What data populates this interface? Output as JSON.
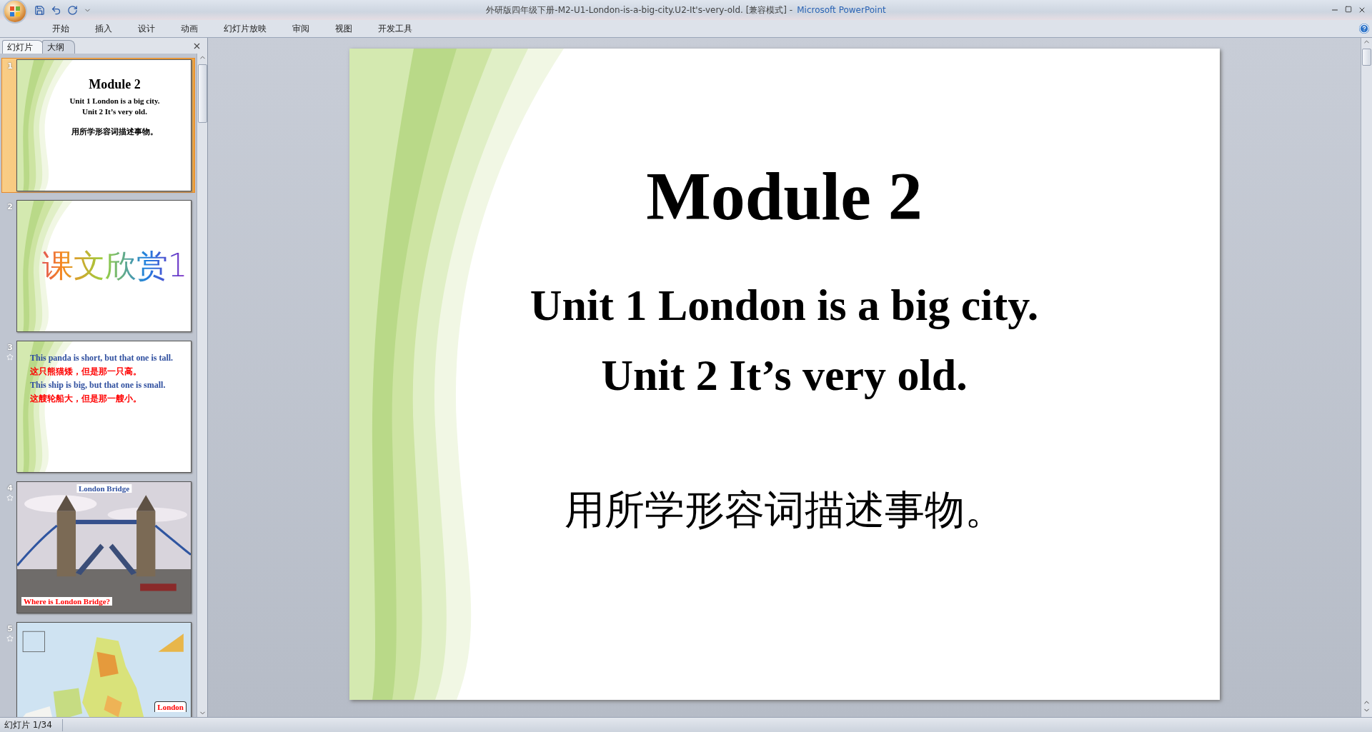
{
  "window": {
    "title": "外研版四年级下册-M2-U1-London-is-a-big-city.U2-It's-very-old. [兼容模式]  -",
    "app_name": "Microsoft PowerPoint"
  },
  "ribbon_tabs": [
    "开始",
    "插入",
    "设计",
    "动画",
    "幻灯片放映",
    "审阅",
    "视图",
    "开发工具"
  ],
  "panel_tabs": [
    {
      "label": "幻灯片",
      "selected": true
    },
    {
      "label": "大纲",
      "selected": false
    }
  ],
  "slides": [
    {
      "number": "1",
      "selected": true,
      "animated": false,
      "kind": "title",
      "title": "Module 2",
      "lines": [
        "Unit 1 London is a big city.",
        "Unit 2 It’s very old."
      ],
      "note": "用所学形容词描述事物。"
    },
    {
      "number": "2",
      "selected": false,
      "animated": false,
      "kind": "art",
      "heading": "课文欣赏1"
    },
    {
      "number": "3",
      "selected": false,
      "animated": true,
      "kind": "text",
      "paragraphs": [
        {
          "text": "This panda is short, but that one is tall.",
          "color": "#2f4f9f"
        },
        {
          "text": "这只熊猫矮，但是那一只高。",
          "color": "#ff0000"
        },
        {
          "text": "This ship is big, but that one is small.",
          "color": "#2f4f9f"
        },
        {
          "text": "这艘轮船大，但是那一艘小。",
          "color": "#ff0000"
        }
      ]
    },
    {
      "number": "4",
      "selected": false,
      "animated": true,
      "caption_top": "London Bridge",
      "caption_bottom": "Where is London Bridge?"
    },
    {
      "number": "5",
      "selected": false,
      "animated": true,
      "kind": "map",
      "label": "London"
    }
  ],
  "current_slide": {
    "title": "Module 2",
    "lines": [
      "Unit 1 London is a big city.",
      "Unit 2 It’s very old."
    ],
    "note": "用所学形容词描述事物。"
  },
  "status_bar": {
    "slide_counter": "幻灯片 1/34"
  }
}
